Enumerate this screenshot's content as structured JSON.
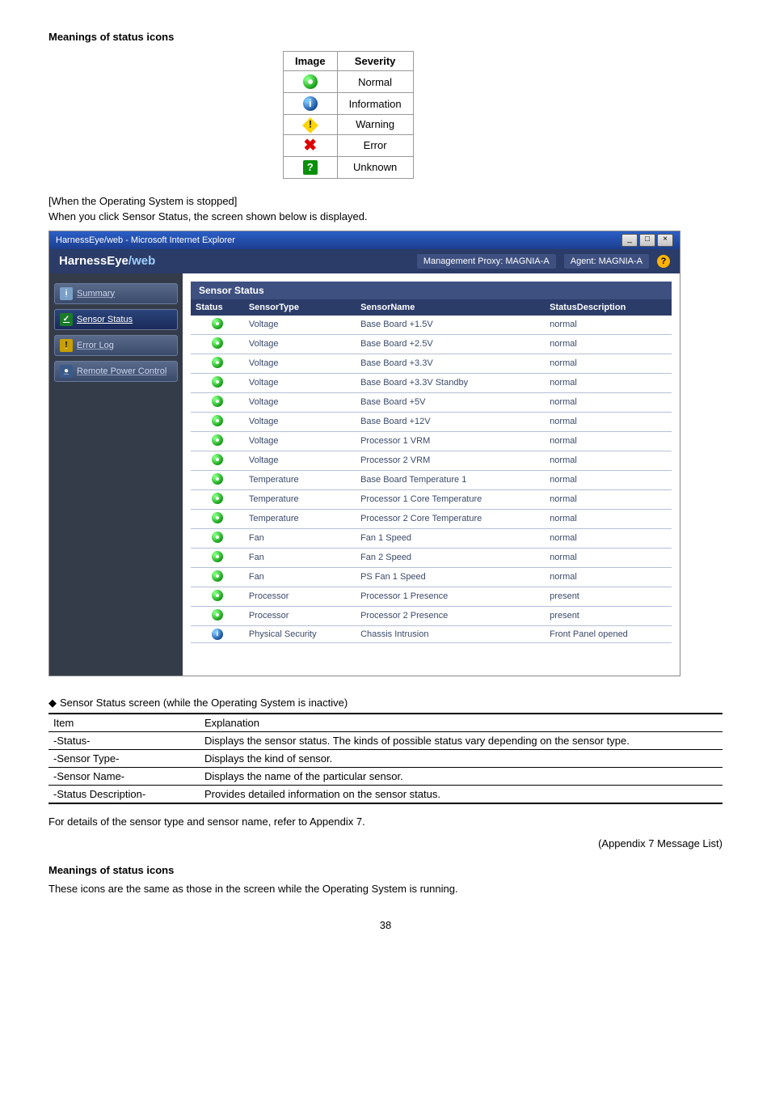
{
  "headings": {
    "meanings1": "Meanings of status icons",
    "meanings2": "Meanings of status icons"
  },
  "severity_table": {
    "headers": {
      "image": "Image",
      "severity": "Severity"
    },
    "rows": [
      {
        "severity": "Normal"
      },
      {
        "severity": "Information"
      },
      {
        "severity": "Warning"
      },
      {
        "severity": "Error"
      },
      {
        "severity": "Unknown"
      }
    ]
  },
  "paragraphs": {
    "whenStopped": "[When the Operating System is stopped]",
    "whenClick": "When you click Sensor Status, the screen shown below is displayed.",
    "forDetails": "For details of the sensor type and sensor name, refer to Appendix 7.",
    "appendixRef": "(Appendix 7 Message List)",
    "iconsSame": "These icons are the same as those in the screen while the Operating System is running.",
    "pageNum": "38"
  },
  "browser": {
    "title": "HarnessEye/web - Microsoft Internet Explorer",
    "min": "_",
    "max": "□",
    "close": "×",
    "logo1": "HarnessEye",
    "logo2": "/web",
    "mgmt": "Management Proxy: MAGNIA-A",
    "agent": "Agent: MAGNIA-A",
    "help": "?"
  },
  "sidebar": {
    "items": [
      {
        "label": "Summary",
        "iconText": "i"
      },
      {
        "label": "Sensor Status",
        "iconText": "✓"
      },
      {
        "label": "Error Log",
        "iconText": "!"
      },
      {
        "label": "Remote Power Control",
        "iconText": "●"
      }
    ]
  },
  "sensor_panel": {
    "title": "Sensor Status",
    "headers": {
      "status": "Status",
      "type": "SensorType",
      "name": "SensorName",
      "desc": "StatusDescription"
    },
    "rows": [
      {
        "icon": "normal",
        "type": "Voltage",
        "name": "Base Board +1.5V",
        "desc": "normal"
      },
      {
        "icon": "normal",
        "type": "Voltage",
        "name": "Base Board +2.5V",
        "desc": "normal"
      },
      {
        "icon": "normal",
        "type": "Voltage",
        "name": "Base Board +3.3V",
        "desc": "normal"
      },
      {
        "icon": "normal",
        "type": "Voltage",
        "name": "Base Board +3.3V Standby",
        "desc": "normal"
      },
      {
        "icon": "normal",
        "type": "Voltage",
        "name": "Base Board +5V",
        "desc": "normal"
      },
      {
        "icon": "normal",
        "type": "Voltage",
        "name": "Base Board +12V",
        "desc": "normal"
      },
      {
        "icon": "normal",
        "type": "Voltage",
        "name": "Processor 1 VRM",
        "desc": "normal"
      },
      {
        "icon": "normal",
        "type": "Voltage",
        "name": "Processor 2 VRM",
        "desc": "normal"
      },
      {
        "icon": "normal",
        "type": "Temperature",
        "name": "Base Board Temperature 1",
        "desc": "normal"
      },
      {
        "icon": "normal",
        "type": "Temperature",
        "name": "Processor 1 Core Temperature",
        "desc": "normal"
      },
      {
        "icon": "normal",
        "type": "Temperature",
        "name": "Processor 2 Core Temperature",
        "desc": "normal"
      },
      {
        "icon": "normal",
        "type": "Fan",
        "name": "Fan 1 Speed",
        "desc": "normal"
      },
      {
        "icon": "normal",
        "type": "Fan",
        "name": "Fan 2 Speed",
        "desc": "normal"
      },
      {
        "icon": "normal",
        "type": "Fan",
        "name": "PS Fan 1 Speed",
        "desc": "normal"
      },
      {
        "icon": "normal",
        "type": "Processor",
        "name": "Processor 1 Presence",
        "desc": "present"
      },
      {
        "icon": "normal",
        "type": "Processor",
        "name": "Processor 2 Presence",
        "desc": "present"
      },
      {
        "icon": "info",
        "type": "Physical Security",
        "name": "Chassis Intrusion",
        "desc": "Front Panel opened"
      }
    ]
  },
  "explain": {
    "caption": "Sensor Status screen (while the Operating System is inactive)",
    "headers": {
      "item": "Item",
      "expl": "Explanation"
    },
    "rows": {
      "status": {
        "item": "-Status-",
        "expl": "Displays the sensor status.  The kinds of possible status vary depending on the sensor type."
      },
      "sensorType": {
        "item": "-Sensor Type-",
        "expl": "Displays the kind of sensor."
      },
      "sensorName": {
        "item": "-Sensor Name-",
        "expl": "Displays the name of the particular sensor."
      },
      "statusDesc": {
        "item": "-Status Description-",
        "expl": "Provides detailed information on the sensor status."
      }
    }
  }
}
